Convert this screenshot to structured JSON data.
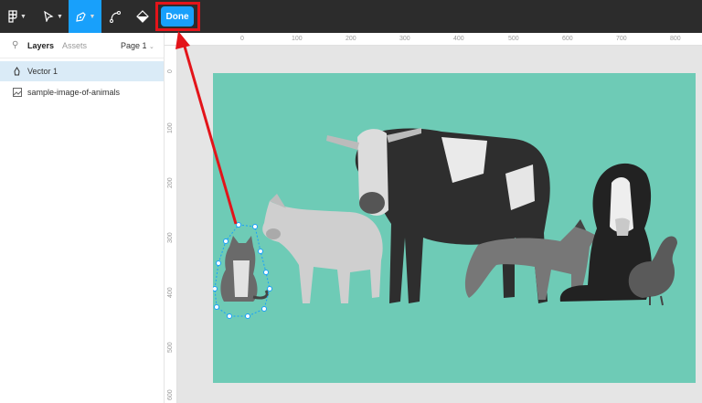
{
  "toolbar": {
    "done_label": "Done",
    "icons": [
      "figma-menu-icon",
      "move-tool-icon",
      "pen-tool-icon",
      "bend-tool-icon",
      "paint-bucket-icon"
    ]
  },
  "sidebar": {
    "tabs": [
      {
        "label": "Layers",
        "active": true
      },
      {
        "label": "Assets",
        "active": false
      }
    ],
    "page_selector": "Page 1",
    "layers": [
      {
        "label": "Vector 1",
        "icon": "vector-icon",
        "selected": true
      },
      {
        "label": "sample-image-of-animals",
        "icon": "image-icon",
        "selected": false
      }
    ]
  },
  "rulers": {
    "top": [
      "0",
      "100",
      "200",
      "300",
      "400",
      "500",
      "600",
      "700",
      "800"
    ],
    "left": [
      "0",
      "100",
      "200",
      "300",
      "400",
      "500",
      "600"
    ]
  },
  "colors": {
    "toolbar_bg": "#2c2c2c",
    "accent": "#18a0fb",
    "annotation": "#e3141a",
    "image_bg": "#6ecbb6"
  }
}
